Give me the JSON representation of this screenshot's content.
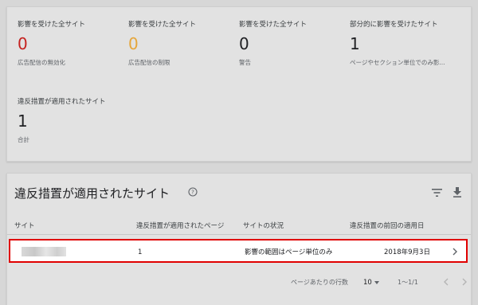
{
  "summary": {
    "metrics": [
      {
        "label": "影響を受けた全サイト",
        "value": "0",
        "sub": "広告配信の無効化",
        "color": "#c5221f"
      },
      {
        "label": "影響を受けた全サイト",
        "value": "0",
        "sub": "広告配信の制限",
        "color": "#e5a63b"
      },
      {
        "label": "影響を受けた全サイト",
        "value": "0",
        "sub": "警告",
        "color": "#202124"
      },
      {
        "label": "部分的に影響を受けたサイト",
        "value": "1",
        "sub": "ページやセクション単位でのみ影...",
        "color": "#202124"
      }
    ],
    "total": {
      "label": "違反措置が適用されたサイト",
      "value": "1",
      "sub": "合計"
    }
  },
  "table": {
    "title": "違反措置が適用されたサイト",
    "icons": {
      "help": "help-icon",
      "filter": "filter-icon",
      "download": "download-icon"
    },
    "columns": [
      "サイト",
      "違反措置が適用されたページ",
      "サイトの状況",
      "違反措置の前回の適用日"
    ],
    "rows": [
      {
        "site": "",
        "pages": "1",
        "status": "影響の範囲はページ単位のみ",
        "date": "2018年9月3日"
      }
    ],
    "highlight_color": "#e00000"
  },
  "pagination": {
    "rows_per_page_label": "ページあたりの行数",
    "rows_per_page_value": "10",
    "range": "1〜1/1"
  }
}
